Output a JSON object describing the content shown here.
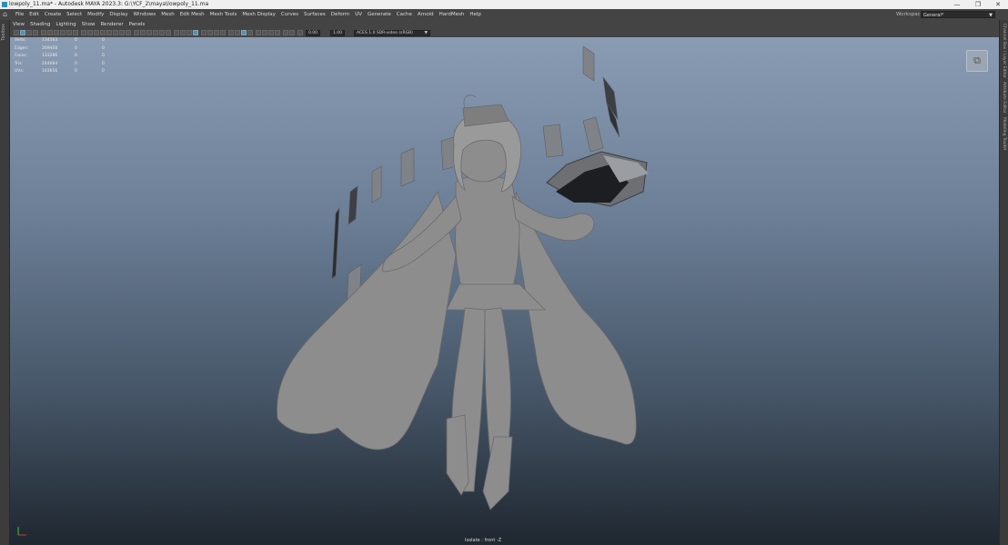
{
  "window": {
    "title": "lowpoly_11.ma* - Autodesk MAYA 2023.3: G:\\YCF_2\\maya\\lowpoly_11.ma",
    "controls": {
      "minimize": "—",
      "restore": "❐",
      "close": "✕"
    }
  },
  "menubar": {
    "items": [
      "File",
      "Edit",
      "Create",
      "Select",
      "Modify",
      "Display",
      "Windows",
      "Mesh",
      "Edit Mesh",
      "Mesh Tools",
      "Mesh Display",
      "Curves",
      "Surfaces",
      "Deform",
      "UV",
      "Generate",
      "Cache",
      "Arnold",
      "HardMesh",
      "Help"
    ],
    "workspace_label": "Workspace:",
    "workspace_value": "General*"
  },
  "side_panels": {
    "left_label": "Toolbox",
    "right_tabs": [
      "Channel Box / Layer Editor",
      "Attribute Editor",
      "Modeling Toolkit"
    ]
  },
  "panel_menu": {
    "items": [
      "View",
      "Shading",
      "Lighting",
      "Show",
      "Renderer",
      "Panels"
    ]
  },
  "toolbar": {
    "field_a": "0.00",
    "field_b": "1.00",
    "color_space": "ACES 1.0 SDR-video (sRGB)"
  },
  "hud": {
    "rows": [
      {
        "label": "Verts:",
        "a": "134563",
        "b": "0",
        "c": "0"
      },
      {
        "label": "Edges:",
        "a": "269408",
        "b": "0",
        "c": "0"
      },
      {
        "label": "Faces:",
        "a": "133286",
        "b": "0",
        "c": "0"
      },
      {
        "label": "Tris:",
        "a": "244694",
        "b": "0",
        "c": "0"
      },
      {
        "label": "UVs:",
        "a": "163656",
        "b": "0",
        "c": "0"
      }
    ]
  },
  "viewport": {
    "camera_label": "Isolate : front -Z",
    "bg_top": "#8a9cb4",
    "bg_bottom": "#1f2730",
    "model_color": "#8d8d8d"
  }
}
